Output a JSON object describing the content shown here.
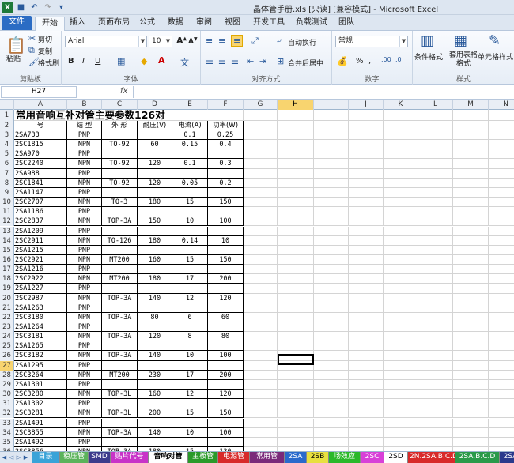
{
  "window": {
    "title": "晶体管手册.xls [只读] [兼容模式] - Microsoft Excel"
  },
  "ribbon_tabs": [
    "文件",
    "开始",
    "插入",
    "页面布局",
    "公式",
    "数据",
    "审阅",
    "视图",
    "开发工具",
    "负载测试",
    "团队"
  ],
  "clipboard": {
    "paste": "粘贴",
    "cut": "剪切",
    "copy": "复制",
    "format_painter": "格式刷",
    "group": "剪贴板"
  },
  "font": {
    "name": "Arial",
    "size": "10",
    "bold": "B",
    "italic": "I",
    "underline": "U",
    "group": "字体",
    "grow": "A",
    "shrink": "A"
  },
  "alignment": {
    "wrap": "自动换行",
    "merge": "合并后居中",
    "group": "对齐方式"
  },
  "number": {
    "format": "常规",
    "percent": "%",
    "comma": ",",
    "group": "数字"
  },
  "styles": {
    "conditional": "条件格式",
    "table_format": "套用表格格式",
    "cell_style": "单元格样式",
    "group": "样式"
  },
  "formula_bar": {
    "name_box": "H27",
    "fx": "fx",
    "formula": ""
  },
  "columns": [
    "A",
    "B",
    "C",
    "D",
    "E",
    "F",
    "G",
    "H",
    "I",
    "J",
    "K",
    "L",
    "M",
    "N"
  ],
  "selected_col": "H",
  "selected_row": "27",
  "sheet": {
    "title": "常用音响互补对管主要参数126对",
    "headers": [
      "号",
      "结 型",
      "外 形",
      "耐压(V)",
      "电流(A)",
      "功率(W)"
    ],
    "rows": [
      [
        "2SA733",
        "PNP",
        "",
        "",
        "0.1",
        "0.25"
      ],
      [
        "2SC1815",
        "NPN",
        "TO-92",
        "60",
        "0.15",
        "0.4"
      ],
      [
        "2SA970",
        "PNP",
        "",
        "",
        "",
        ""
      ],
      [
        "2SC2240",
        "NPN",
        "TO-92",
        "120",
        "0.1",
        "0.3"
      ],
      [
        "2SA988",
        "PNP",
        "",
        "",
        "",
        ""
      ],
      [
        "2SC1841",
        "NPN",
        "TO-92",
        "120",
        "0.05",
        "0.2"
      ],
      [
        "2SA1147",
        "PNP",
        "",
        "",
        "",
        ""
      ],
      [
        "2SC2707",
        "NPN",
        "TO-3",
        "180",
        "15",
        "150"
      ],
      [
        "2SA1186",
        "PNP",
        "",
        "",
        "",
        ""
      ],
      [
        "2SC2837",
        "NPN",
        "TOP-3A",
        "150",
        "10",
        "100"
      ],
      [
        "2SA1209",
        "PNP",
        "",
        "",
        "",
        ""
      ],
      [
        "2SC2911",
        "NPN",
        "TO-126",
        "180",
        "0.14",
        "10"
      ],
      [
        "2SA1215",
        "PNP",
        "",
        "",
        "",
        ""
      ],
      [
        "2SC2921",
        "NPN",
        "MT200",
        "160",
        "15",
        "150"
      ],
      [
        "2SA1216",
        "PNP",
        "",
        "",
        "",
        ""
      ],
      [
        "2SC2922",
        "NPN",
        "MT200",
        "180",
        "17",
        "200"
      ],
      [
        "2SA1227",
        "PNP",
        "",
        "",
        "",
        ""
      ],
      [
        "2SC2987",
        "NPN",
        "TOP-3A",
        "140",
        "12",
        "120"
      ],
      [
        "2SA1263",
        "PNP",
        "",
        "",
        "",
        ""
      ],
      [
        "2SC3180",
        "NPN",
        "TOP-3A",
        "80",
        "6",
        "60"
      ],
      [
        "2SA1264",
        "PNP",
        "",
        "",
        "",
        ""
      ],
      [
        "2SC3181",
        "NPN",
        "TOP-3A",
        "120",
        "8",
        "80"
      ],
      [
        "2SA1265",
        "PNP",
        "",
        "",
        "",
        ""
      ],
      [
        "2SC3182",
        "NPN",
        "TOP-3A",
        "140",
        "10",
        "100"
      ],
      [
        "2SA1295",
        "PNP",
        "",
        "",
        "",
        ""
      ],
      [
        "2SC3264",
        "NPN",
        "MT200",
        "230",
        "17",
        "200"
      ],
      [
        "2SA1301",
        "PNP",
        "",
        "",
        "",
        ""
      ],
      [
        "2SC3280",
        "NPN",
        "TOP-3L",
        "160",
        "12",
        "120"
      ],
      [
        "2SA1302",
        "PNP",
        "",
        "",
        "",
        ""
      ],
      [
        "2SC3281",
        "NPN",
        "TOP-3L",
        "200",
        "15",
        "150"
      ],
      [
        "2SA1491",
        "PNP",
        "",
        "",
        "",
        ""
      ],
      [
        "2SC3855",
        "NPN",
        "TOP-3A",
        "140",
        "10",
        "100"
      ],
      [
        "2SA1492",
        "PNP",
        "",
        "",
        "",
        ""
      ],
      [
        "2SC3856",
        "NPN",
        "TOP-3A",
        "180",
        "15",
        "130"
      ]
    ]
  },
  "sheet_tabs": [
    {
      "label": "目录",
      "bg": "#3aa3d8"
    },
    {
      "label": "稳压管",
      "bg": "#5bb35b"
    },
    {
      "label": "SMD",
      "bg": "#3c3c8c"
    },
    {
      "label": "贴片代号",
      "bg": "#c833c8"
    },
    {
      "label": "音响对管",
      "bg": "#ffffff"
    },
    {
      "label": "主板管",
      "bg": "#2a9a2a"
    },
    {
      "label": "电源管",
      "bg": "#d82a2a"
    },
    {
      "label": "常用管",
      "bg": "#7a2a7a"
    },
    {
      "label": "2SA",
      "bg": "#2a6acc"
    },
    {
      "label": "2SB",
      "bg": "#e8e040"
    },
    {
      "label": "场效应",
      "bg": "#2ab82a"
    },
    {
      "label": "2SC",
      "bg": "#d840d8"
    },
    {
      "label": "2SD",
      "bg": "#ffffff"
    },
    {
      "label": "2N.2SA.B.C.D",
      "bg": "#d82a2a"
    },
    {
      "label": "2SA.B.C.D",
      "bg": "#2a9a4a"
    },
    {
      "label": "2SA.B.C.D",
      "bg": "#2a3a8c"
    }
  ]
}
